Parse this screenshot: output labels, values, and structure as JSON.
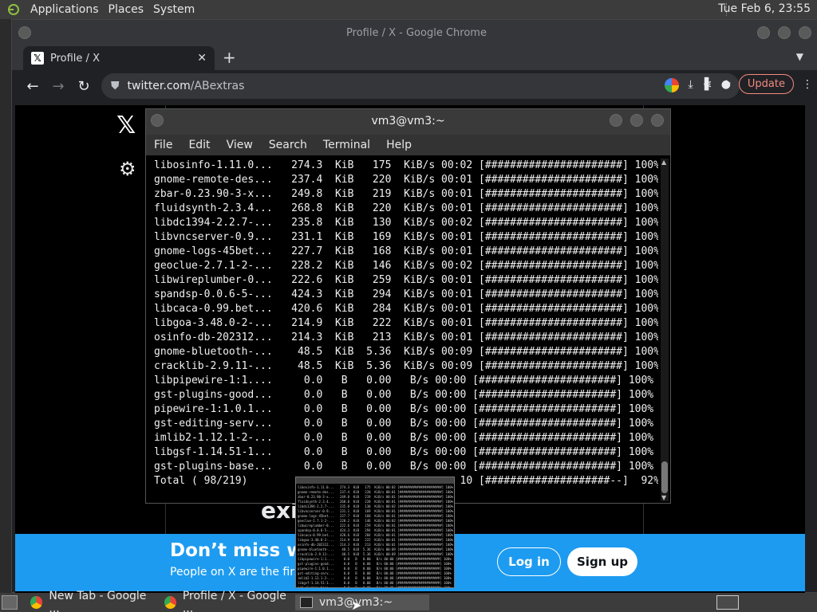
{
  "top_panel": {
    "menus": [
      "Applications",
      "Places",
      "System"
    ],
    "clock": "Tue Feb  6, 23:55"
  },
  "chrome": {
    "window_title": "Profile / X - Google Chrome",
    "tab_title": "Profile / X",
    "url_host": "twitter.com",
    "url_path": "/ABextras",
    "update_label": "Update"
  },
  "page": {
    "big_text": "exi",
    "banner_heading": "Don’t miss wh",
    "banner_sub": "People on X are the firs",
    "login_label": "Log in",
    "signup_label": "Sign up"
  },
  "terminal": {
    "title": "vm3@vm3:~",
    "menu": [
      "File",
      "Edit",
      "View",
      "Search",
      "Terminal",
      "Help"
    ],
    "lines": [
      "libosinfo-1.11.0...   274.3  KiB   175  KiB/s 00:02 [######################] 100%",
      "gnome-remote-des...   237.4  KiB   220  KiB/s 00:01 [######################] 100%",
      "zbar-0.23.90-3-x...   249.8  KiB   219  KiB/s 00:01 [######################] 100%",
      "fluidsynth-2.3.4...   268.8  KiB   220  KiB/s 00:01 [######################] 100%",
      "libdc1394-2.2.7-...   235.8  KiB   130  KiB/s 00:02 [######################] 100%",
      "libvncserver-0.9...   231.1  KiB   169  KiB/s 00:01 [######################] 100%",
      "gnome-logs-45bet...   227.7  KiB   168  KiB/s 00:01 [######################] 100%",
      "geoclue-2.7.1-2-...   228.2  KiB   146  KiB/s 00:02 [######################] 100%",
      "libwireplumber-0...   222.6  KiB   259  KiB/s 00:01 [######################] 100%",
      "spandsp-0.0.6-5-...   424.3  KiB   294  KiB/s 00:01 [######################] 100%",
      "libcaca-0.99.bet...   420.6  KiB   284  KiB/s 00:01 [######################] 100%",
      "libgoa-3.48.0-2-...   214.9  KiB   222  KiB/s 00:01 [######################] 100%",
      "osinfo-db-202312...   214.3  KiB   213  KiB/s 00:01 [######################] 100%",
      "gnome-bluetooth-...    48.5  KiB  5.36  KiB/s 00:09 [######################] 100%",
      "cracklib-2.9.11-...    48.5  KiB  5.36  KiB/s 00:09 [######################] 100%",
      "libpipewire-1:1....     0.0   B   0.00   B/s 00:00 [######################] 100%",
      "gst-plugins-good...     0.0   B   0.00   B/s 00:00 [######################] 100%",
      "pipewire-1:1.0.1...     0.0   B   0.00   B/s 00:00 [######################] 100%",
      "gst-editing-serv...     0.0   B   0.00   B/s 00:00 [######################] 100%",
      "imlib2-1.12.1-2-...     0.0   B   0.00   B/s 00:00 [######################] 100%",
      "libgsf-1.14.51-1...     0.0   B   0.00   B/s 00:00 [######################] 100%",
      "gst-plugins-base...     0.0   B   0.00   B/s 00:00 [######################] 100%",
      "Total ( 98/219)                                  10 [####################--]  92%"
    ]
  },
  "taskbar": {
    "tasks": [
      "New Tab - Google ...",
      "Profile / X - Google ...",
      "vm3@vm3:~"
    ]
  }
}
